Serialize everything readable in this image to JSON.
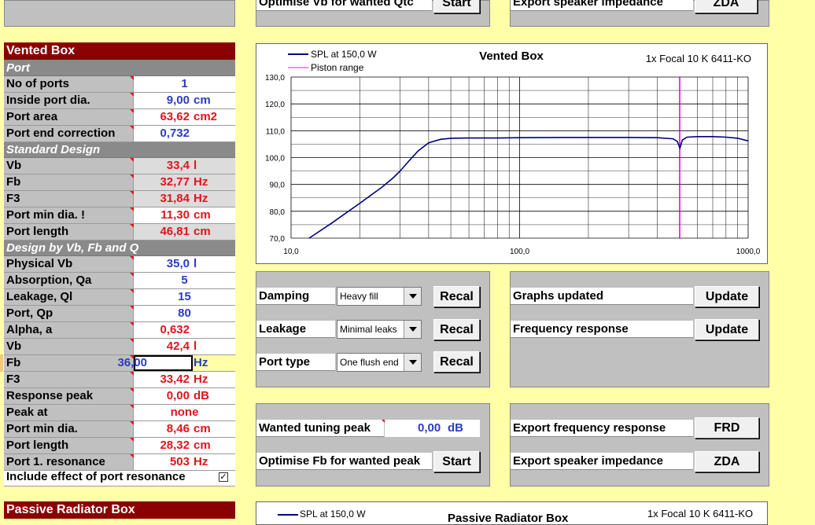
{
  "top": {
    "optimise_vb_label": "Optimise Vb for wanted Qtc",
    "start_label": "Start",
    "export_imp_label": "Export speaker impedance",
    "zda_label": "ZDA"
  },
  "vented": {
    "title": "Vented Box",
    "port_section": "Port",
    "rows_port": [
      {
        "label": "No of ports",
        "value": "1",
        "unit": "",
        "color": "blue"
      },
      {
        "label": "Inside port dia.",
        "value": "9,00",
        "unit": "cm",
        "color": "blue"
      },
      {
        "label": "Port area",
        "value": "63,62",
        "unit": "cm2",
        "color": "red"
      },
      {
        "label": "Port end correction",
        "value": "0,732",
        "unit": "",
        "color": "blue"
      }
    ],
    "standard_section": "Standard Design",
    "rows_standard": [
      {
        "label": "Vb",
        "value": "33,4",
        "unit": "l"
      },
      {
        "label": "Fb",
        "value": "32,77",
        "unit": "Hz"
      },
      {
        "label": "F3",
        "value": "31,84",
        "unit": "Hz"
      },
      {
        "label": "Port min dia. !",
        "value": "11,30",
        "unit": "cm"
      },
      {
        "label": "Port length",
        "value": "46,81",
        "unit": "cm"
      }
    ],
    "design_section": "Design by Vb, Fb and Q",
    "rows_design": [
      {
        "label": "Physical Vb",
        "value": "35,0",
        "unit": "l",
        "color": "blue"
      },
      {
        "label": "Absorption, Qa",
        "value": "5",
        "unit": "",
        "color": "blue"
      },
      {
        "label": "Leakage, Ql",
        "value": "15",
        "unit": "",
        "color": "blue"
      },
      {
        "label": "Port, Qp",
        "value": "80",
        "unit": "",
        "color": "blue"
      },
      {
        "label": "Alpha, a",
        "value": "0,632",
        "unit": "",
        "color": "red"
      },
      {
        "label": "Vb",
        "value": "42,4",
        "unit": "l",
        "color": "red"
      },
      {
        "label": "Fb",
        "value": "36,00",
        "unit": "Hz",
        "color": "blue"
      },
      {
        "label": "F3",
        "value": "33,42",
        "unit": "Hz",
        "color": "red"
      },
      {
        "label": "Response peak",
        "value": "0,00",
        "unit": "dB",
        "color": "red"
      },
      {
        "label": "Peak at",
        "value": "none",
        "unit": "",
        "color": "red"
      },
      {
        "label": "Port min dia.",
        "value": "8,46",
        "unit": "cm",
        "color": "red"
      },
      {
        "label": "Port length",
        "value": "28,32",
        "unit": "cm",
        "color": "red"
      },
      {
        "label": "Port 1. resonance",
        "value": "503",
        "unit": "Hz",
        "color": "red"
      }
    ],
    "include_label": "Include effect of port resonance",
    "include_checked": "✓"
  },
  "passive": {
    "title": "Passive Radiator Box",
    "legend_spl": "SPL at 150,0 W",
    "chart_title": "Passive Radiator Box",
    "driver": "1x Focal 10 K 6411-KO"
  },
  "controls": {
    "damping_label": "Damping",
    "damping_value": "Heavy fill",
    "leakage_label": "Leakage",
    "leakage_value": "Minimal leaks",
    "port_type_label": "Port type",
    "port_type_value": "One flush end",
    "recal_label": "Recal"
  },
  "updates": {
    "graphs_label": "Graphs updated",
    "freq_label": "Frequency response",
    "update_label": "Update"
  },
  "tuning": {
    "wanted_peak_label": "Wanted tuning peak",
    "wanted_peak_value": "0,00",
    "wanted_peak_unit": "dB",
    "optimise_fb_label": "Optimise Fb for wanted peak",
    "start_label": "Start"
  },
  "export": {
    "freq_label": "Export frequency response",
    "frd_label": "FRD",
    "imp_label": "Export speaker impedance",
    "zda_label": "ZDA"
  },
  "chart_data": {
    "type": "line",
    "title": "Vented Box",
    "subtitle": "1x Focal 10 K 6411-KO",
    "legend": [
      "SPL at 150,0 W",
      "Piston range"
    ],
    "x_scale": "log",
    "xlim": [
      10,
      1000
    ],
    "ylim": [
      70,
      130
    ],
    "x_ticks": [
      "10,0",
      "100,0",
      "1000,0"
    ],
    "y_ticks": [
      "70,0",
      "80,0",
      "90,0",
      "100,0",
      "110,0",
      "120,0",
      "130,0"
    ],
    "grid": true,
    "legend_position": "top-left",
    "series": [
      {
        "name": "SPL at 150,0 W",
        "color": "#000080",
        "x": [
          12,
          15,
          20,
          25,
          28,
          30,
          33,
          36,
          40,
          45,
          50,
          60,
          80,
          100,
          150,
          200,
          300,
          400,
          470,
          490,
          503,
          515,
          540,
          600,
          700,
          800,
          900,
          1000
        ],
        "y": [
          70,
          75.5,
          83,
          89,
          92.5,
          95,
          99,
          102.5,
          105.5,
          106.8,
          107.2,
          107.3,
          107.3,
          107.4,
          107.5,
          107.5,
          107.5,
          107.4,
          107,
          106,
          103.5,
          106.5,
          107.6,
          107.8,
          107.8,
          107.6,
          107.2,
          106.2
        ]
      },
      {
        "name": "Piston range",
        "color": "#ff00ff",
        "vline": 503
      }
    ]
  }
}
